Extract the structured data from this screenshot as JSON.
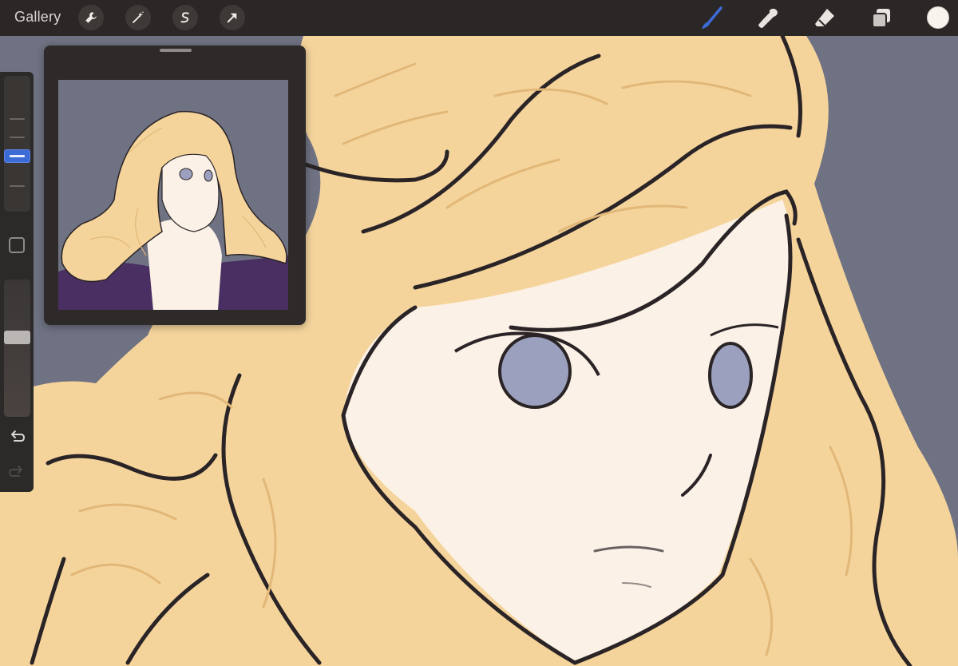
{
  "toolbar": {
    "gallery_label": "Gallery",
    "left_tools": [
      {
        "name": "actions",
        "icon": "wrench-icon"
      },
      {
        "name": "adjustments",
        "icon": "magic-wand-icon"
      },
      {
        "name": "selection",
        "icon": "selection-s-icon"
      },
      {
        "name": "transform",
        "icon": "arrow-cursor-icon"
      }
    ],
    "right_tools": [
      {
        "name": "brush",
        "icon": "brush-icon",
        "active": true
      },
      {
        "name": "smudge",
        "icon": "smudge-icon"
      },
      {
        "name": "eraser",
        "icon": "eraser-icon"
      },
      {
        "name": "layers",
        "icon": "layers-icon"
      }
    ],
    "active_color": "#f8f3ec"
  },
  "sidebar": {
    "brush_size_icon": "size-slider",
    "modify_icon": "square-icon",
    "undo_icon": "undo-arrow-icon",
    "redo_icon": "redo-arrow-icon"
  },
  "colors": {
    "canvas_bg": "#6f7282",
    "hair": "#f5d49c",
    "hair_strand": "#e2b777",
    "skin": "#fbf1e6",
    "line": "#2a2426",
    "eye": "#9aa0bd",
    "cloth": "#4a2f62",
    "accent_blue": "#3d6bd6"
  }
}
